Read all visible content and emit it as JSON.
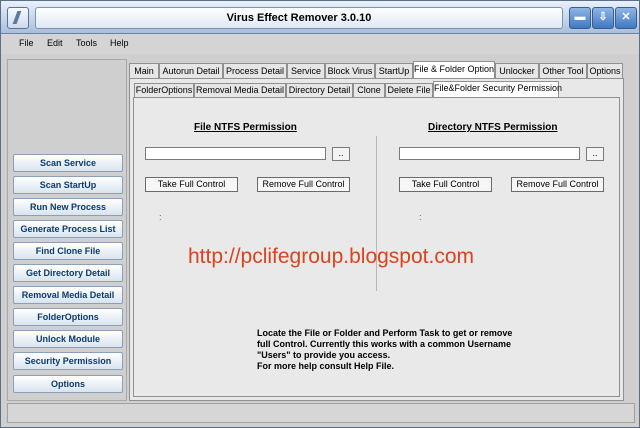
{
  "window": {
    "title": "Virus Effect Remover 3.0.10"
  },
  "menu": [
    "File",
    "Edit",
    "Tools",
    "Help"
  ],
  "sidebar": [
    "Scan Service",
    "Scan StartUp",
    "Run New Process",
    "Generate Process List",
    "Find Clone File",
    "Get Directory Detail",
    "Removal Media Detail",
    "FolderOptions",
    "Unlock Module",
    "Security Permission",
    "Options"
  ],
  "tabs": [
    "Main",
    "Autorun Detail",
    "Process Detail",
    "Service",
    "Block Virus",
    "StartUp",
    "File & Folder Option",
    "Unlocker",
    "Other Tool",
    "Options"
  ],
  "subtabs": [
    "FolderOptions",
    "Removal Media Detail",
    "Directory Detail",
    "Clone",
    "Delete File",
    "File&Folder Security Permission"
  ],
  "file_section": {
    "heading": "File NTFS Permission",
    "path_value": "",
    "browse_label": "..",
    "take_label": "Take Full Control",
    "remove_label": "Remove Full Control",
    "result": ":"
  },
  "dir_section": {
    "heading": "Directory NTFS Permission",
    "path_value": "",
    "browse_label": "..",
    "take_label": "Take Full Control",
    "remove_label": "Remove Full Control",
    "result": ":"
  },
  "overlay_text": "http://pclifegroup.blogspot.com",
  "info_lines": [
    "Locate the File  or Folder and Perform Task to get or remove",
    "full Control. Currently this works with a common Username",
    "\"Users\" to provide you access.",
    "For more help consult Help File."
  ]
}
